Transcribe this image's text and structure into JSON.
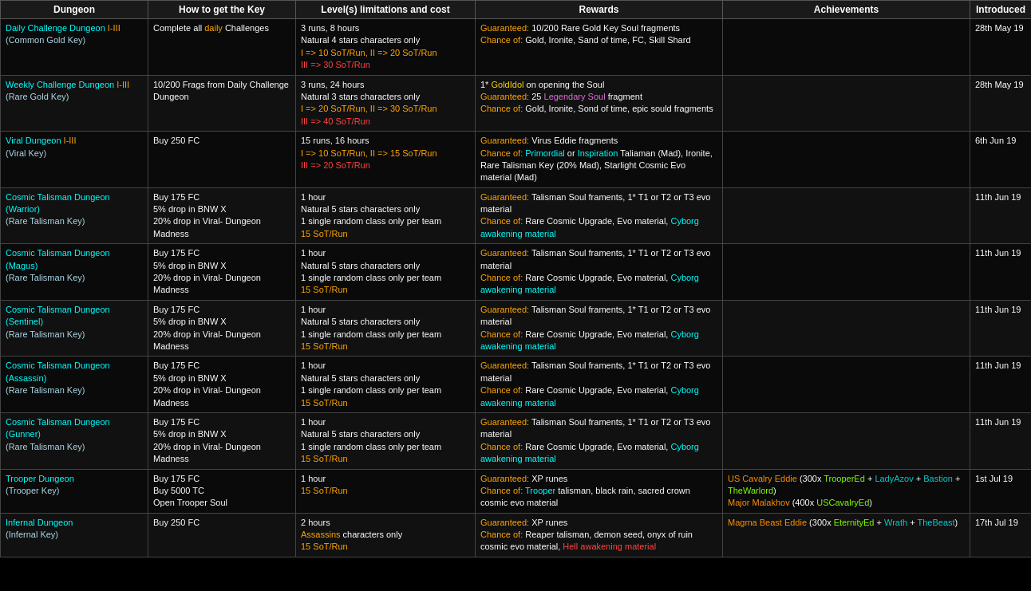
{
  "table": {
    "headers": [
      "Dungeon",
      "How to get the Key",
      "Level(s) limitations and cost",
      "Rewards",
      "Achievements",
      "Introduced"
    ],
    "rows": [
      {
        "dungeon": "Daily Challenge Dungeon I-III",
        "dungeon_sub": "(Common Gold Key)",
        "key": "Complete all daily Challenges",
        "level": [
          "3 runs, 8 hours",
          "Natural 4 stars characters only",
          "I => 10 SoT/Run, II => 20 SoT/Run",
          "III => 30 SoT/Run"
        ],
        "rewards_guaranteed": "Guaranteed: 10/200 Rare Gold Key Soul fragments",
        "rewards_chance": "Chance of: Gold, Ironite, Sand of time, FC, Skill Shard",
        "achievements": "",
        "introduced": "28th May 19"
      },
      {
        "dungeon": "Weekly Challenge Dungeon I-III",
        "dungeon_sub": "(Rare Gold Key)",
        "key": "10/200 Frags from Daily Challenge Dungeon",
        "level": [
          "3 runs, 24 hours",
          "Natural 3 stars characters only",
          "I => 20 SoT/Run, II => 30 SoT/Run",
          "III => 40 SoT/Run"
        ],
        "rewards_guaranteed": "1* GoldIdol on opening the Soul\nGuaranteed: 25 Legendary Soul fragment",
        "rewards_chance": "Chance of: Gold, Ironite, Sond of time, epic sould fragments",
        "achievements": "",
        "introduced": "28th May 19"
      },
      {
        "dungeon": "Viral Dungeon I-III",
        "dungeon_sub": "(Viral Key)",
        "key": "Buy 250 FC",
        "level": [
          "15 runs, 16 hours",
          "I => 10 SoT/Run, II => 15 SoT/Run",
          "III => 20 SoT/Run"
        ],
        "rewards_guaranteed": "Guaranteed: Virus Eddie fragments",
        "rewards_chance": "Chance of: Primordial or Inspiration Taliaman (Mad), Ironite, Rare Talisman Key (20% Mad), Starlight Cosmic Evo material (Mad)",
        "achievements": "",
        "introduced": "6th Jun 19"
      },
      {
        "dungeon": "Cosmic Talisman Dungeon (Warrior)",
        "dungeon_sub": "(Rare Talisman Key)",
        "key": "Buy 175 FC\n5% drop in BNW X\n20% drop in Viral- Dungeon Madness",
        "level": [
          "1 hour",
          "Natural 5 stars characters only",
          "1 single random class only per team",
          "15 SoT/Run"
        ],
        "rewards_guaranteed": "Guaranteed: Talisman Soul framents, 1* T1 or T2 or T3 evo material",
        "rewards_chance": "Chance of: Rare Cosmic Upgrade, Evo material, Cyborg awakening material",
        "achievements": "",
        "introduced": "11th Jun 19"
      },
      {
        "dungeon": "Cosmic Talisman Dungeon (Magus)",
        "dungeon_sub": "(Rare Talisman Key)",
        "key": "Buy 175 FC\n5% drop in BNW X\n20% drop in Viral- Dungeon Madness",
        "level": [
          "1 hour",
          "Natural 5 stars characters only",
          "1 single random class only per team",
          "15 SoT/Run"
        ],
        "rewards_guaranteed": "Guaranteed: Talisman Soul framents, 1* T1 or T2 or T3 evo material",
        "rewards_chance": "Chance of: Rare Cosmic Upgrade, Evo material, Cyborg awakening material",
        "achievements": "",
        "introduced": "11th Jun 19"
      },
      {
        "dungeon": "Cosmic Talisman Dungeon (Sentinel)",
        "dungeon_sub": "(Rare Talisman Key)",
        "key": "Buy 175 FC\n5% drop in BNW X\n20% drop in Viral- Dungeon Madness",
        "level": [
          "1 hour",
          "Natural 5 stars characters only",
          "1 single random class only per team",
          "15 SoT/Run"
        ],
        "rewards_guaranteed": "Guaranteed: Talisman Soul framents, 1* T1 or T2 or T3 evo material",
        "rewards_chance": "Chance of: Rare Cosmic Upgrade, Evo material, Cyborg awakening material",
        "achievements": "",
        "introduced": "11th Jun 19"
      },
      {
        "dungeon": "Cosmic Talisman Dungeon (Assassin)",
        "dungeon_sub": "(Rare Talisman Key)",
        "key": "Buy 175 FC\n5% drop in BNW X\n20% drop in Viral- Dungeon Madness",
        "level": [
          "1 hour",
          "Natural 5 stars characters only",
          "1 single random class only per team",
          "15 SoT/Run"
        ],
        "rewards_guaranteed": "Guaranteed: Talisman Soul framents, 1* T1 or T2 or T3 evo material",
        "rewards_chance": "Chance of: Rare Cosmic Upgrade, Evo material, Cyborg awakening material",
        "achievements": "",
        "introduced": "11th Jun 19"
      },
      {
        "dungeon": "Cosmic Talisman Dungeon (Gunner)",
        "dungeon_sub": "(Rare Talisman Key)",
        "key": "Buy 175 FC\n5% drop in BNW X\n20% drop in Viral- Dungeon Madness",
        "level": [
          "1 hour",
          "Natural 5 stars characters only",
          "1 single random class only per team",
          "15 SoT/Run"
        ],
        "rewards_guaranteed": "Guaranteed: Talisman Soul framents, 1* T1 or T2 or T3 evo material",
        "rewards_chance": "Chance of: Rare Cosmic Upgrade, Evo material, Cyborg awakening material",
        "achievements": "",
        "introduced": "11th Jun 19"
      },
      {
        "dungeon": "Trooper Dungeon",
        "dungeon_sub": "(Trooper Key)",
        "key": "Buy 175 FC\nBuy 5000 TC\nOpen Trooper Soul",
        "level": [
          "1 hour",
          "15 SoT/Run"
        ],
        "rewards_guaranteed": "Guaranteed: XP runes",
        "rewards_chance": "Chance of: Trooper talisman, black rain, sacred crown cosmic evo material",
        "achievements": "US Cavalry Eddie (300x TrooperEd + LadyAzov + Bastion + TheWarlord)\nMajor Malakhov (400x USCavalryEd)",
        "introduced": "1st Jul 19"
      },
      {
        "dungeon": "Infernal Dungeon",
        "dungeon_sub": "(Infernal Key)",
        "key": "Buy 250 FC",
        "level": [
          "2 hours",
          "Assassins characters only",
          "15 SoT/Run"
        ],
        "rewards_guaranteed": "Guaranteed: XP runes",
        "rewards_chance": "Chance of: Reaper talisman, demon seed, onyx of ruin cosmic evo material, Hell awakening material",
        "achievements": "Magma Beast Eddie (300x EternityEd + Wrath + TheBeast)",
        "introduced": "17th Jul 19"
      }
    ]
  }
}
